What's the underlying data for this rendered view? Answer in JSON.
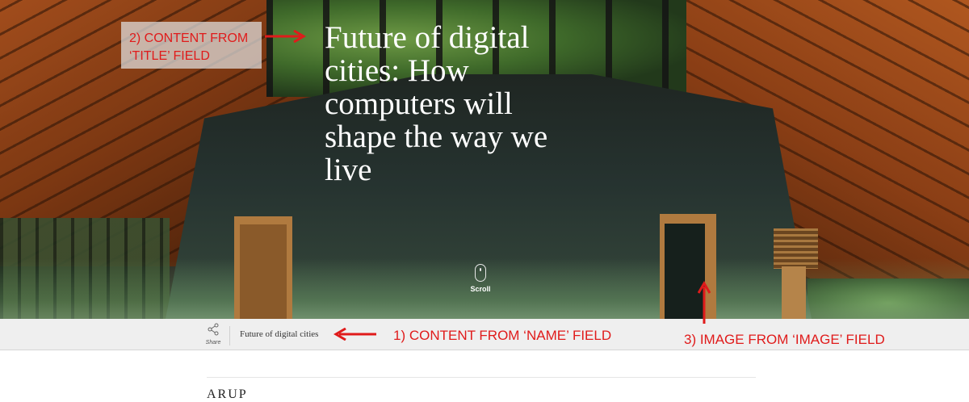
{
  "hero": {
    "title": "Future of digital cities: How computers will shape the way we live",
    "scroll_label": "Scroll",
    "scroll_icon": "mouse-icon"
  },
  "annotations": {
    "title_field_line1": "2) CONTENT FROM",
    "title_field_line2": "‘TITLE’ FIELD",
    "name_field": "1) CONTENT FROM ‘NAME’ FIELD",
    "image_field": "3) IMAGE FROM ‘IMAGE’ FIELD",
    "color": "#e01b1b"
  },
  "sticky_bar": {
    "share_label": "Share",
    "share_icon": "share-icon",
    "name": "Future of digital cities"
  },
  "content": {
    "heading_partial": "ARUP"
  }
}
